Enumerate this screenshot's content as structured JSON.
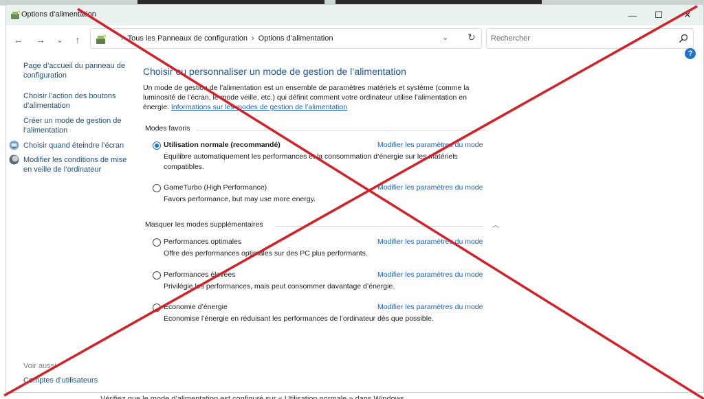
{
  "window": {
    "title": "Options d’alimentation",
    "controls": {
      "minimize": "—",
      "maximize": "☐",
      "close": "✕"
    }
  },
  "navigation": {
    "back": "←",
    "forward": "→",
    "recent": "⌄",
    "up": "↑",
    "breadcrumbs": [
      "Tous les Panneaux de configuration",
      "Options d’alimentation"
    ],
    "dropdown": "⌄",
    "refresh": "↻",
    "search_placeholder": "Rechercher"
  },
  "help": "?",
  "sidebar": {
    "items": [
      {
        "label": "Page d’accueil du panneau de configuration"
      },
      {
        "label": "Choisir l’action des boutons d’alimentation"
      },
      {
        "label": "Créer un mode de gestion de l’alimentation"
      },
      {
        "label": "Choisir quand éteindre l’écran",
        "icon": "monitor-icon"
      },
      {
        "label": "Modifier les conditions de mise en veille de l’ordinateur",
        "icon": "moon-icon"
      }
    ],
    "see_also": "Voir aussi",
    "user_accounts": "Comptes d’utilisateurs"
  },
  "main": {
    "title": "Choisir ou personnaliser un mode de gestion de l’alimentation",
    "intro": "Un mode de gestion de l’alimentation est un ensemble de paramètres matériels et système (comme la luminosité de l’écran, le mode veille, etc.) qui définit comment votre ordinateur utilise l’alimentation en énergie.",
    "intro_link": "Informations sur les modes de gestion de l’alimentation",
    "favorites_header": "Modes favoris",
    "hidden_header": "Masquer les modes supplémentaires",
    "change_link": "Modifier les paramètres du mode",
    "plans": [
      {
        "name": "Utilisation normale (recommandé)",
        "desc": "Équilibre automatiquement les performances et la consommation d’énergie sur les matériels compatibles.",
        "selected": true
      },
      {
        "name": "GameTurbo (High Performance)",
        "desc": "Favors performance, but may use more energy.",
        "selected": false
      },
      {
        "name": "Performances optimales",
        "desc": "Offre des performances optimales sur des PC plus performants.",
        "selected": false
      },
      {
        "name": "Performances élevées",
        "desc": "Privilégie les performances, mais peut consommer davantage d’énergie.",
        "selected": false
      },
      {
        "name": "Économie d’énergie",
        "desc": "Économise l’énergie en réduisant les performances de l’ordinateur dès que possible.",
        "selected": false
      }
    ]
  },
  "bottom_text": "Vérifiez que le mode d’alimentation est configuré sur « Utilisation normale » dans Windows",
  "colors": {
    "accent": "#1f73c9",
    "link": "#1e62b6",
    "title": "#1e5294",
    "cross": "#d42027"
  }
}
